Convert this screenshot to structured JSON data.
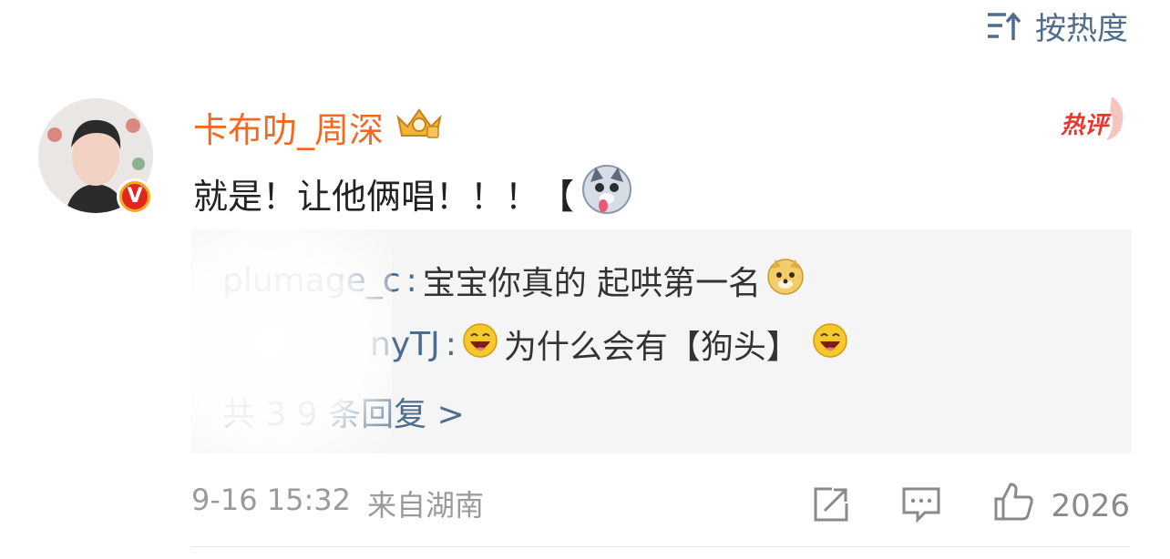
{
  "sort": {
    "label": "按热度",
    "icon": "sort-icon"
  },
  "comment": {
    "username": "卡布叻_周深",
    "badge_icon": "crown-badge-icon",
    "verified_icon": "verified-v-icon",
    "hot_label": "热评",
    "text": "就是！让他俩唱！！！【",
    "text_emoji": "husky-dog-emoji-icon",
    "replies": [
      {
        "user": "plumage_c",
        "text": "宝宝你真的 起哄第一名",
        "emoji_after": "doge-emoji-icon"
      },
      {
        "user": "nyTJ",
        "text": "为什么会有【狗头】",
        "emoji_before": "laugh-emoji-icon",
        "emoji_after": "laugh-emoji-icon"
      }
    ],
    "more_replies": "共 3 9 条回复 >",
    "date": "9-16 15:32",
    "source": "来自湖南",
    "like_count": "2026"
  },
  "colors": {
    "username": "#f06a22",
    "link": "#4e6c8c",
    "reply_bg": "#f5f5f5",
    "hot": "#e8372e"
  }
}
